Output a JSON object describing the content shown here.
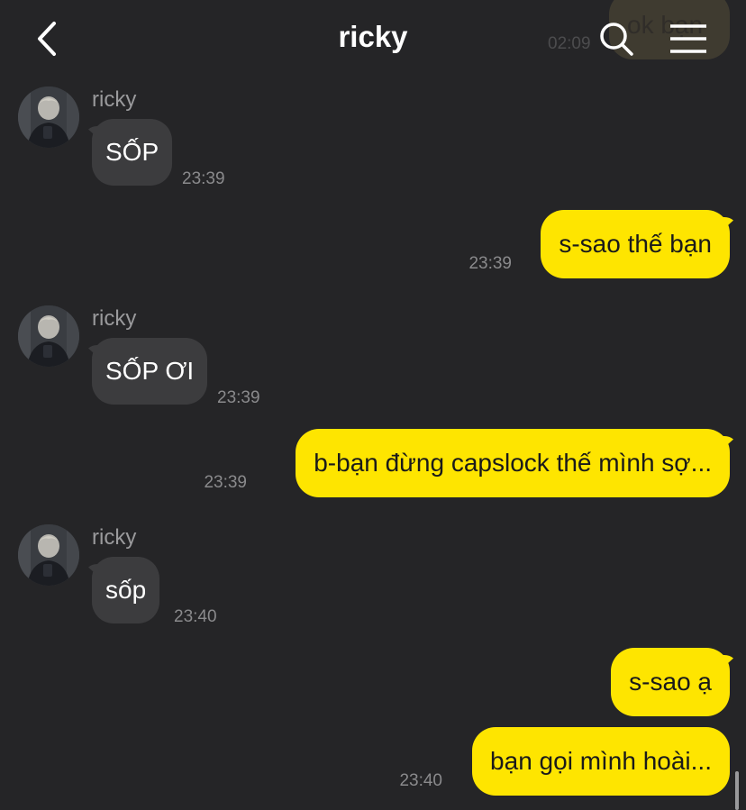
{
  "header": {
    "title": "ricky",
    "back_icon": "chevron-left-icon",
    "search_icon": "search-icon",
    "menu_icon": "hamburger-menu-icon",
    "ghost_message": "ok bạn",
    "ghost_time": "02:09"
  },
  "colors": {
    "background": "#252527",
    "incoming_bubble": "#3c3c3e",
    "outgoing_bubble": "#fee500",
    "timestamp": "#8a8a8c"
  },
  "messages": [
    {
      "sender": "ricky",
      "text": "SỐP",
      "time": "23:39",
      "direction": "incoming"
    },
    {
      "text": "s-sao thế bạn",
      "time": "23:39",
      "direction": "outgoing"
    },
    {
      "sender": "ricky",
      "text": "SỐP ƠI",
      "time": "23:39",
      "direction": "incoming"
    },
    {
      "text": "b-bạn đừng capslock thế mình sợ...",
      "time": "23:39",
      "direction": "outgoing"
    },
    {
      "sender": "ricky",
      "text": "sốp",
      "time": "23:40",
      "direction": "incoming"
    },
    {
      "text": "s-sao ạ",
      "time": "",
      "direction": "outgoing"
    },
    {
      "text": "bạn gọi mình hoài...",
      "time": "23:40",
      "direction": "outgoing"
    }
  ]
}
